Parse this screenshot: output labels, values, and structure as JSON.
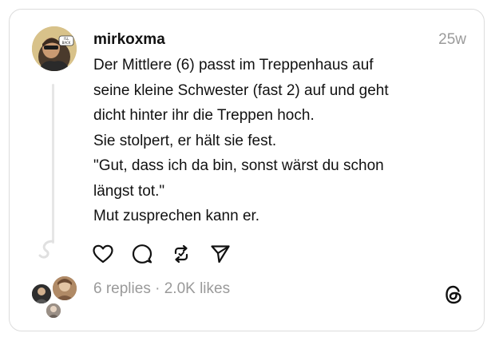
{
  "post": {
    "username": "mirkoxma",
    "timestamp": "25w",
    "body_lines": [
      "Der Mittlere (6) passt im Treppenhaus auf",
      "seine kleine Schwester (fast 2) auf und geht",
      "dicht hinter ihr die Treppen hoch.",
      "Sie stolpert, er hält sie fest.",
      "\"Gut, dass ich da bin, sonst wärst du schon",
      "längst tot.\"",
      "Mut zusprechen kann er."
    ],
    "replies": "6 replies",
    "separator": "·",
    "likes": "2.0K likes",
    "avatar_badge": "I'LL BE BACK"
  },
  "actions": [
    {
      "name": "like",
      "icon": "heart-icon"
    },
    {
      "name": "reply",
      "icon": "comment-icon"
    },
    {
      "name": "repost",
      "icon": "repost-icon"
    },
    {
      "name": "share",
      "icon": "send-icon"
    }
  ],
  "colors": {
    "text": "#111111",
    "muted": "#9a9a9a",
    "border": "#dcdcdc",
    "thread_line": "#e6e6e6"
  }
}
